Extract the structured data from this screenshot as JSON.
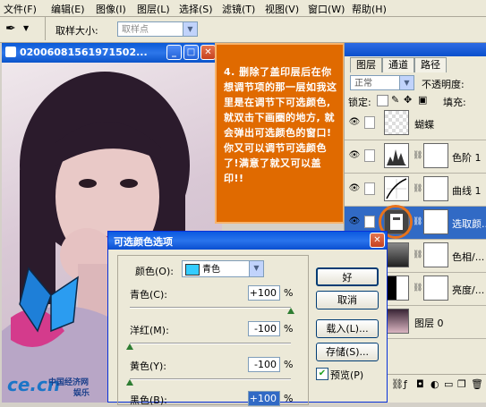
{
  "menu": [
    "文件(F)",
    "编辑(E)",
    "图像(I)",
    "图层(L)",
    "选择(S)",
    "滤镜(T)",
    "视图(V)",
    "窗口(W)",
    "帮助(H)"
  ],
  "options": {
    "sample_size_label": "取样大小:",
    "sample_size_value": "取样点"
  },
  "document": {
    "title": "02006081561971502...",
    "watermark_brand": "ce.cn",
    "watermark_text": "中国经济网",
    "watermark_sub": "娱乐"
  },
  "note": {
    "text": "4. 删除了盖印层后在你想调节项的那一层如我这里是在调节下可选颜色, 就双击下画圈的地方, 就会弹出可选颜色的窗口!你又可以调节可选颜色了!满意了就又可以盖印!!"
  },
  "layers": {
    "tabs": [
      "图层",
      "通道",
      "路径"
    ],
    "blend_mode": "正常",
    "opacity_label": "不透明度:",
    "lock_label": "锁定:",
    "fill_label": "填充:",
    "items": [
      {
        "name": "蝴蝶"
      },
      {
        "name": "色阶 1"
      },
      {
        "name": "曲线 1"
      },
      {
        "name": "选取颜..."
      },
      {
        "name": "色相/..."
      },
      {
        "name": "亮度/..."
      },
      {
        "name": "图层 0"
      }
    ]
  },
  "dialog": {
    "title": "可选颜色选项",
    "colors_label": "颜色(O):",
    "colors_value": "青色",
    "swatch_color": "#33ccff",
    "rows": [
      {
        "label": "青色(C):",
        "value": "+100",
        "unit": "%",
        "level_pct": 100
      },
      {
        "label": "洋红(M):",
        "value": "-100",
        "unit": "%",
        "level_pct": 0
      },
      {
        "label": "黄色(Y):",
        "value": "-100",
        "unit": "%",
        "level_pct": 0
      },
      {
        "label": "黑色(B):",
        "value": "+100",
        "unit": "%",
        "level_pct": 100
      }
    ],
    "ok": "好",
    "cancel": "取消",
    "load": "载入(L)...",
    "save": "存储(S)...",
    "preview": "预览(P)",
    "preview_checked": true
  }
}
